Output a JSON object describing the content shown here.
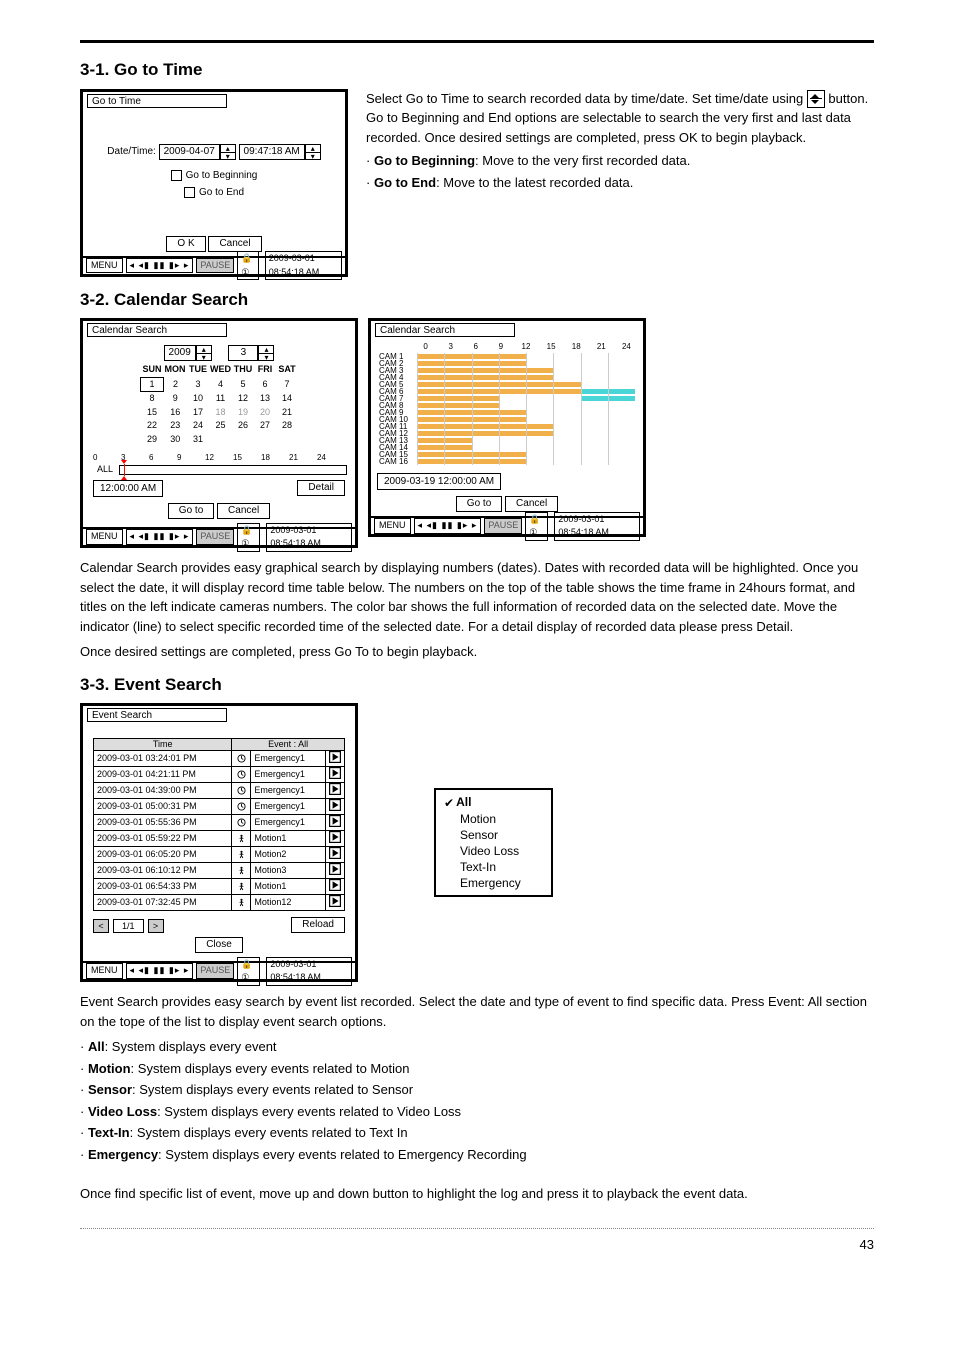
{
  "page_number": "43",
  "h31": "3-1. Go to Time",
  "h32": "3-2. Calendar Search",
  "h33": "3-3. Event Search",
  "goto": {
    "win_title": "Go to Time",
    "dt_label": "Date/Time:",
    "date": "2009-04-07",
    "time": "09:47:18 AM",
    "cb_begin": "Go to Beginning",
    "cb_end": "Go to End",
    "ok": "O K",
    "cancel": "Cancel",
    "menu": "MENU",
    "transport": "◂ ◂▮ ▮▮ ▮▸ ▸",
    "pause": "PAUSE",
    "lock": "🔒①",
    "ts": "2009-03-01 08:54:18 AM"
  },
  "goto_desc": {
    "p1a": "Select Go to Time to search recorded data by time/date. Set time/date using ",
    "p1b": " button. Go to Beginning and End options are selectable to search the very first and last data recorded. Once desired settings are completed, press OK to begin playback.",
    "b1_strong": "Go to Beginning",
    "b1_rest": ": Move to the very first recorded data.",
    "b2_strong": "Go to End",
    "b2_rest": ": Move to the latest recorded data."
  },
  "cal": {
    "win_title": "Calendar Search",
    "year": "2009",
    "month": "3",
    "dow": [
      "SUN",
      "MON",
      "TUE",
      "WED",
      "THU",
      "FRI",
      "SAT"
    ],
    "weeks": [
      [
        "1",
        "2",
        "3",
        "4",
        "5",
        "6",
        "7"
      ],
      [
        "8",
        "9",
        "10",
        "11",
        "12",
        "13",
        "14"
      ],
      [
        "15",
        "16",
        "17",
        "18",
        "19",
        "20",
        "21"
      ],
      [
        "22",
        "23",
        "24",
        "25",
        "26",
        "27",
        "28"
      ],
      [
        "29",
        "30",
        "31",
        "",
        "",
        "",
        ""
      ]
    ],
    "dim_cells": [
      "18",
      "19",
      "20"
    ],
    "hl_cell": "1",
    "tl_labels": [
      "0",
      "3",
      "6",
      "9",
      "12",
      "15",
      "18",
      "21",
      "24"
    ],
    "all": "ALL",
    "readout": "12:00:00 AM",
    "detail": "Detail",
    "goto": "Go to",
    "cancel": "Cancel",
    "menu": "MENU",
    "transport": "◂ ◂▮ ▮▮ ▮▸ ▸",
    "pause": "PAUSE",
    "lock": "🔒①",
    "ts": "2009-03-01 08:54:18 AM"
  },
  "cal2": {
    "win_title": "Calendar Search",
    "hours": [
      "0",
      "3",
      "6",
      "9",
      "12",
      "15",
      "18",
      "21",
      "24"
    ],
    "cams": [
      "CAM 1",
      "CAM 2",
      "CAM 3",
      "CAM 4",
      "CAM 5",
      "CAM 6",
      "CAM 7",
      "CAM 8",
      "CAM 9",
      "CAM 10",
      "CAM 11",
      "CAM 12",
      "CAM 13",
      "CAM 14",
      "CAM 15",
      "CAM 16"
    ],
    "readout": "2009-03-19 12:00:00 AM",
    "goto": "Go to",
    "cancel": "Cancel",
    "menu": "MENU",
    "transport": "◂ ◂▮ ▮▮ ▮▸ ▸",
    "pause": "PAUSE",
    "lock": "🔒①",
    "ts": "2009-03-01 08:54:18 AM"
  },
  "cal_para1": "Calendar Search provides easy graphical search by displaying numbers (dates). Dates with recorded data will be highlighted. Once you select the date, it will display record time table below. The numbers on the top of the table shows the time frame in 24hours format, and titles on the left indicate cameras numbers. The color bar shows the full information of recorded data on the selected date. Move the indicator (line) to select specific recorded time of the selected date. For a detail display of recorded data please press Detail.",
  "cal_para2": "Once desired settings are completed, press Go To to begin playback.",
  "evt": {
    "win_title": "Event Search",
    "col_time": "Time",
    "col_event": "Event : All",
    "rows": [
      {
        "t": "2009-03-01 03:24:01 PM",
        "ic": "clock",
        "e": "Emergency1"
      },
      {
        "t": "2009-03-01 04:21:11 PM",
        "ic": "clock",
        "e": "Emergency1"
      },
      {
        "t": "2009-03-01 04:39:00 PM",
        "ic": "clock",
        "e": "Emergency1"
      },
      {
        "t": "2009-03-01 05:00:31 PM",
        "ic": "clock",
        "e": "Emergency1"
      },
      {
        "t": "2009-03-01 05:55:36 PM",
        "ic": "clock",
        "e": "Emergency1"
      },
      {
        "t": "2009-03-01 05:59:22 PM",
        "ic": "run",
        "e": "Motion1"
      },
      {
        "t": "2009-03-01 06:05:20 PM",
        "ic": "run",
        "e": "Motion2"
      },
      {
        "t": "2009-03-01 06:10:12 PM",
        "ic": "run",
        "e": "Motion3"
      },
      {
        "t": "2009-03-01 06:54:33 PM",
        "ic": "run",
        "e": "Motion1"
      },
      {
        "t": "2009-03-01 07:32:45 PM",
        "ic": "run",
        "e": "Motion12"
      }
    ],
    "page": "1/1",
    "reload": "Reload",
    "close": "Close",
    "menu": "MENU",
    "transport": "◂ ◂▮ ▮▮ ▮▸ ▸",
    "pause": "PAUSE",
    "lock": "🔒①",
    "ts": "2009-03-01 08:54:18 AM"
  },
  "evt_options": {
    "all": "All",
    "motion": "Motion",
    "sensor": "Sensor",
    "vloss": "Video Loss",
    "textin": "Text-In",
    "emerg": "Emergency"
  },
  "evt_para1": "Event Search provides easy search by event list recorded. Select the date and type of event to find specific data. Press Event: All section on the tope of the list to display event search options.",
  "evt_bullets": [
    {
      "s": "All",
      "r": ": System displays every event"
    },
    {
      "s": "Motion",
      "r": ": System displays every events related to Motion"
    },
    {
      "s": "Sensor",
      "r": ": System displays every events related to Sensor"
    },
    {
      "s": "Video Loss",
      "r": ": System displays every events related to Video Loss"
    },
    {
      "s": "Text-In",
      "r": ": System displays every events related to Text In"
    },
    {
      "s": "Emergency",
      "r": ": System displays every events related to Emergency Recording"
    }
  ],
  "evt_para2": "Once find specific list of event, move up and down button to highlight the log and press it to playback the event data."
}
